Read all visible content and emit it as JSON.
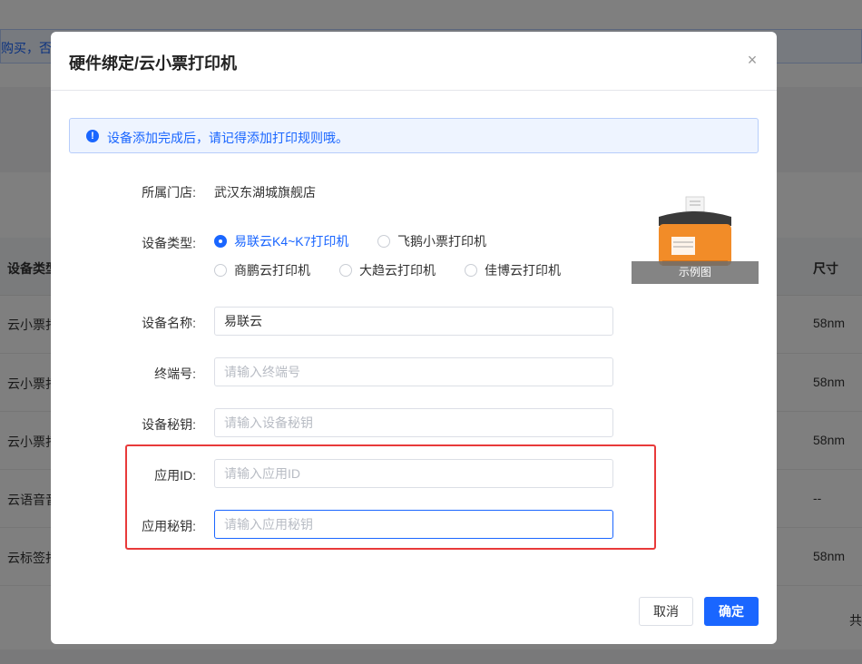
{
  "background": {
    "banner_text": "购买，否则",
    "table_headers": {
      "device_type": "设备类型",
      "size": "尺寸"
    },
    "rows": [
      {
        "type": "云小票打",
        "size": "58nm"
      },
      {
        "type": "云小票打",
        "size": "58nm"
      },
      {
        "type": "云小票打",
        "size": "58nm"
      },
      {
        "type": "云语音音",
        "size": "--"
      },
      {
        "type": "云标签打",
        "size": "58nm"
      }
    ],
    "footer_text": "共"
  },
  "dialog": {
    "title": "硬件绑定/云小票打印机",
    "close_icon": "×",
    "alert": {
      "icon": "!",
      "text": "设备添加完成后，请记得添加打印规则哦。"
    },
    "store": {
      "label": "所属门店:",
      "value": "武汉东湖城旗舰店"
    },
    "device_type": {
      "label": "设备类型:",
      "options": [
        {
          "label": "易联云K4~K7打印机",
          "checked": true
        },
        {
          "label": "飞鹅小票打印机",
          "checked": false
        },
        {
          "label": "商鹏云打印机",
          "checked": false
        },
        {
          "label": "大趋云打印机",
          "checked": false
        },
        {
          "label": "佳博云打印机",
          "checked": false
        }
      ]
    },
    "preview_caption": "示例图",
    "fields": {
      "device_name": {
        "label": "设备名称:",
        "value": "易联云",
        "placeholder": ""
      },
      "terminal_no": {
        "label": "终端号:",
        "value": "",
        "placeholder": "请输入终端号"
      },
      "device_secret": {
        "label": "设备秘钥:",
        "value": "",
        "placeholder": "请输入设备秘钥"
      },
      "app_id": {
        "label": "应用ID:",
        "value": "",
        "placeholder": "请输入应用ID"
      },
      "app_secret": {
        "label": "应用秘钥:",
        "value": "",
        "placeholder": "请输入应用秘钥"
      }
    },
    "buttons": {
      "cancel": "取消",
      "confirm": "确定"
    }
  }
}
